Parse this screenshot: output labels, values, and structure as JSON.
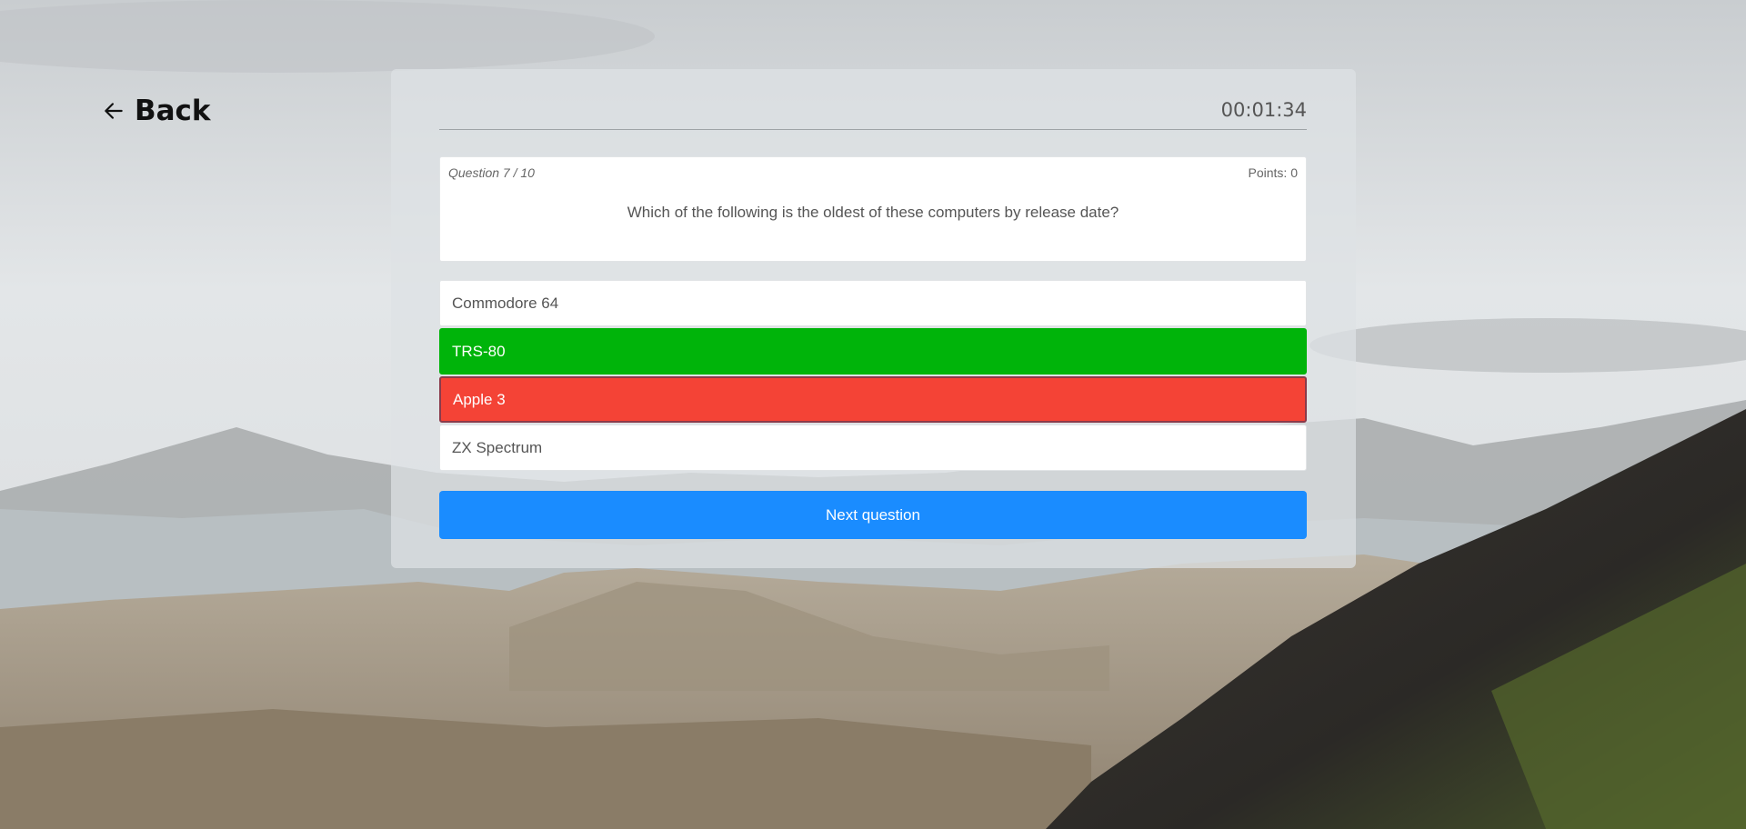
{
  "nav": {
    "back_label": "Back",
    "back_icon": "arrow-left-icon"
  },
  "quiz": {
    "timer": "00:01:34",
    "question_counter": "Question 7 / 10",
    "points": "Points: 0",
    "question": "Which of the following is the oldest of these computers by release date?",
    "answers": [
      {
        "label": "Commodore 64",
        "state": "neutral"
      },
      {
        "label": "TRS-80",
        "state": "correct"
      },
      {
        "label": "Apple 3",
        "state": "wrong"
      },
      {
        "label": "ZX Spectrum",
        "state": "neutral"
      }
    ],
    "next_label": "Next question"
  },
  "colors": {
    "correct": "#00b40a",
    "wrong": "#f44336",
    "primary": "#1a8cff"
  }
}
